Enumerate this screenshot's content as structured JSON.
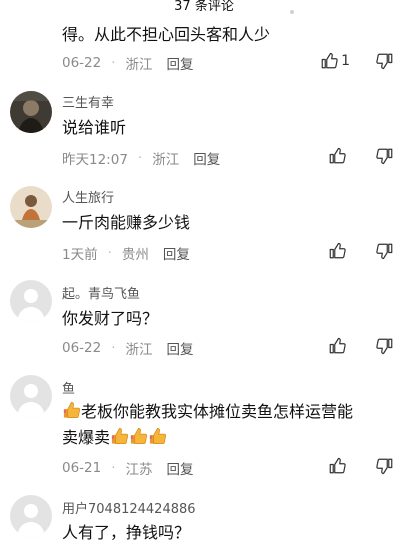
{
  "header": {
    "count_label": "37 条评论"
  },
  "comments": [
    {
      "user": "",
      "text": "得。从此不担心回头客和人少",
      "date": "06-22",
      "location": "浙江",
      "reply": "回复",
      "likes": "1"
    },
    {
      "user": "三生有幸",
      "text": "说给谁听",
      "date": "昨天12:07",
      "location": "浙江",
      "reply": "回复",
      "likes": ""
    },
    {
      "user": "人生旅行",
      "text": "一斤肉能赚多少钱",
      "date": "1天前",
      "location": "贵州",
      "reply": "回复",
      "likes": ""
    },
    {
      "user": "起。青鸟飞鱼",
      "text": "你发财了吗？",
      "date": "06-22",
      "location": "浙江",
      "reply": "回复",
      "likes": ""
    },
    {
      "user": "鱼",
      "text_line1": "老板你能教我实体摊位卖鱼怎样运营能",
      "text_line2": "卖爆卖",
      "date": "06-21",
      "location": "江苏",
      "reply": "回复",
      "likes": ""
    },
    {
      "user": "用户7048124424886",
      "text": "人有了，挣钱吗？",
      "date": "",
      "location": "",
      "reply": "",
      "likes": ""
    }
  ],
  "icons": {
    "like": "thumbs-up-icon",
    "dislike": "thumbs-down-icon",
    "emoji": "thumbs-up-emoji"
  },
  "colors": {
    "meta": "#8a8a8a",
    "text": "#111111",
    "emoji": "#f5a623"
  }
}
